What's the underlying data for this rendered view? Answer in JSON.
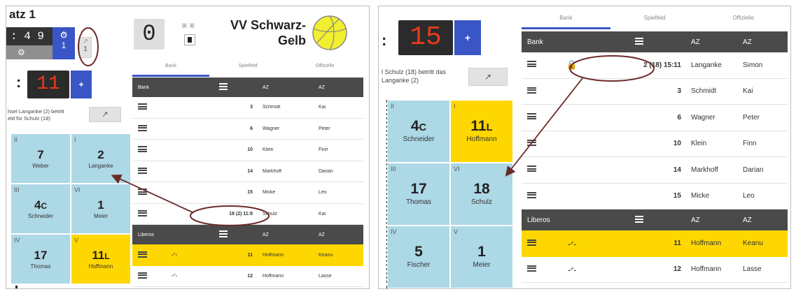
{
  "left": {
    "set_title": "atz 1",
    "timer": ": 4 9",
    "timeout_badge": "1",
    "sub_badge": "1",
    "team_score": "0",
    "team_name_line1": "VV Schwarz-",
    "team_name_line2": "Gelb",
    "score_other": "11",
    "plus": "+",
    "sub_message_line1": "hsel Langanke (2) betritt",
    "sub_message_line2": "eld für Schulz (18)",
    "court": [
      {
        "roman": "II",
        "num": "7",
        "sub": "",
        "name": "Weber"
      },
      {
        "roman": "I",
        "num": "2",
        "sub": "",
        "name": "Langanke"
      },
      {
        "roman": "III",
        "num": "4",
        "sub": "C",
        "name": "Schneider"
      },
      {
        "roman": "VI",
        "num": "1",
        "sub": "",
        "name": "Meier"
      },
      {
        "roman": "IV",
        "num": "17",
        "sub": "",
        "name": "Thomas"
      },
      {
        "roman": "V",
        "num": "11",
        "sub": "L",
        "name": "Hoffmann"
      }
    ],
    "tabs": [
      "Bank",
      "Spielfeld",
      "Offizielle"
    ],
    "bank_header": {
      "label": "Bank",
      "c2": "AZ",
      "c3": "AZ"
    },
    "bank_rows": [
      {
        "num": "3",
        "last": "Schmidt",
        "first": "Kai"
      },
      {
        "num": "6",
        "last": "Wagner",
        "first": "Peter"
      },
      {
        "num": "10",
        "last": "Klein",
        "first": "Finn"
      },
      {
        "num": "14",
        "last": "Markhoff",
        "first": "Darian"
      },
      {
        "num": "15",
        "last": "Micke",
        "first": "Leo"
      },
      {
        "num": "18 (2) 11:8",
        "last": "Schulz",
        "first": "Kai"
      }
    ],
    "libero_header": {
      "label": "Liberos",
      "c2": "AZ",
      "c3": "AZ"
    },
    "libero_rows": [
      {
        "num": "11",
        "last": "Hoffmann",
        "first": "Keanu"
      },
      {
        "num": "12",
        "last": "Hoffmann",
        "first": "Lasse"
      }
    ]
  },
  "right": {
    "score": "15",
    "plus": "+",
    "sub_message_line1": "l Schulz (18) betritt das",
    "sub_message_line2": "Langanke (2)",
    "tabs": [
      "Bank",
      "Spielfeld",
      "Offizielle"
    ],
    "bank_header": {
      "label": "Bank",
      "c2": "AZ",
      "c3": "AZ"
    },
    "bank_rows": [
      {
        "num": "2 (18) 15:11",
        "last": "Langanke",
        "first": "Simon",
        "locked": true
      },
      {
        "num": "3",
        "last": "Schmidt",
        "first": "Kai"
      },
      {
        "num": "6",
        "last": "Wagner",
        "first": "Peter"
      },
      {
        "num": "10",
        "last": "Klein",
        "first": "Finn"
      },
      {
        "num": "14",
        "last": "Markhoff",
        "first": "Darian"
      },
      {
        "num": "15",
        "last": "Micke",
        "first": "Leo"
      }
    ],
    "libero_header": {
      "label": "Liberos",
      "c2": "AZ",
      "c3": "AZ"
    },
    "libero_rows": [
      {
        "num": "11",
        "last": "Hoffmann",
        "first": "Keanu"
      },
      {
        "num": "12",
        "last": "Hoffmann",
        "first": "Lasse"
      }
    ],
    "court": [
      {
        "roman": "II",
        "num": "4",
        "sub": "C",
        "name": "Schneider"
      },
      {
        "roman": "I",
        "num": "11",
        "sub": "L",
        "name": "Hoffmann"
      },
      {
        "roman": "III",
        "num": "17",
        "sub": "",
        "name": "Thomas"
      },
      {
        "roman": "VI",
        "num": "18",
        "sub": "",
        "name": "Schulz"
      },
      {
        "roman": "IV",
        "num": "5",
        "sub": "",
        "name": "Fischer"
      },
      {
        "roman": "V",
        "num": "1",
        "sub": "",
        "name": "Meier"
      }
    ]
  },
  "colors": {
    "court": "#add8e6",
    "libero": "#ffd700",
    "accent": "#3a56c6",
    "score": "#e83a1a",
    "annotation": "#6b2a2a"
  }
}
